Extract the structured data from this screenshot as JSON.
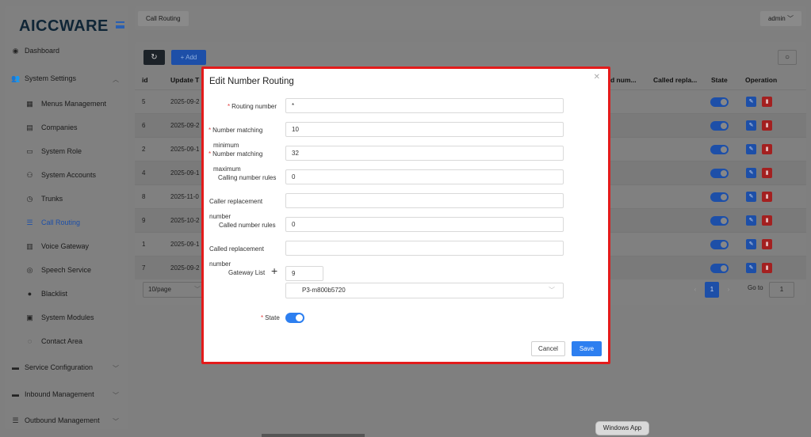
{
  "app": {
    "logo": "AICCWARE"
  },
  "sidebar": {
    "items": [
      {
        "label": "Dashboard",
        "icon": "dashboard-icon",
        "glyph": "◉",
        "level": "top"
      },
      {
        "label": "System Settings",
        "icon": "users-icon",
        "glyph": "👥",
        "level": "top",
        "expanded": true
      },
      {
        "label": "Menus Management",
        "icon": "grid-icon",
        "glyph": "▦",
        "level": "sub"
      },
      {
        "label": "Companies",
        "icon": "table-icon",
        "glyph": "▤",
        "level": "sub"
      },
      {
        "label": "System Role",
        "icon": "role-icon",
        "glyph": "▭",
        "level": "sub"
      },
      {
        "label": "System Accounts",
        "icon": "user-icon",
        "glyph": "⚇",
        "level": "sub"
      },
      {
        "label": "Trunks",
        "icon": "clock-icon",
        "glyph": "◷",
        "level": "sub"
      },
      {
        "label": "Call Routing",
        "icon": "list-icon",
        "glyph": "☰",
        "level": "sub",
        "active": true
      },
      {
        "label": "Voice Gateway",
        "icon": "calendar-icon",
        "glyph": "▥",
        "level": "sub"
      },
      {
        "label": "Speech Service",
        "icon": "speech-icon",
        "glyph": "◎",
        "level": "sub"
      },
      {
        "label": "Blacklist",
        "icon": "person-icon",
        "glyph": "●",
        "level": "sub"
      },
      {
        "label": "System Modules",
        "icon": "modules-icon",
        "glyph": "▣",
        "level": "sub"
      },
      {
        "label": "Contact Area",
        "icon": "location-icon",
        "glyph": "◌",
        "level": "sub"
      },
      {
        "label": "Service Configuration",
        "icon": "config-icon",
        "glyph": "▬",
        "level": "top",
        "expanded": false
      },
      {
        "label": "Inbound Management",
        "icon": "inbound-icon",
        "glyph": "▬",
        "level": "top",
        "expanded": false
      },
      {
        "label": "Outbound Management",
        "icon": "outbound-icon",
        "glyph": "☰",
        "level": "top",
        "expanded": false
      }
    ]
  },
  "topbar": {
    "breadcrumb": "Call Routing",
    "user": "admin"
  },
  "toolbar": {
    "add_label": "+ Add"
  },
  "table": {
    "headers": {
      "id": "id",
      "update": "Update T",
      "called_num": "d num...",
      "called_repl": "Called repla...",
      "state": "State",
      "operation": "Operation"
    },
    "rows": [
      {
        "id": "5",
        "update": "2025-09-2"
      },
      {
        "id": "6",
        "update": "2025-09-2"
      },
      {
        "id": "2",
        "update": "2025-09-1"
      },
      {
        "id": "4",
        "update": "2025-09-1"
      },
      {
        "id": "8",
        "update": "2025-11-0"
      },
      {
        "id": "9",
        "update": "2025-10-2"
      },
      {
        "id": "1",
        "update": "2025-09-1"
      },
      {
        "id": "7",
        "update": "2025-09-2"
      }
    ]
  },
  "pagination": {
    "page_size": "10/page",
    "current_page": "1",
    "goto_label": "Go to",
    "goto_value": "1"
  },
  "modal": {
    "title": "Edit Number Routing",
    "routing_number_label": "Routing number",
    "routing_number_value": "*",
    "min_label_1": "Number matching",
    "min_label_2": "minimum",
    "min_value": "10",
    "max_label_1": "Number matching",
    "max_label_2": "maximum",
    "max_value": "32",
    "calling_rules_label": "Calling number rules",
    "calling_rules_value": "0",
    "caller_repl_label_1": "Caller replacement",
    "caller_repl_label_2": "number",
    "caller_repl_value": "",
    "called_rules_label": "Called number rules",
    "called_rules_value": "0",
    "called_repl_label_1": "Called replacement",
    "called_repl_label_2": "number",
    "called_repl_value": "",
    "gateway_label": "Gateway List",
    "gateway_count": "9",
    "gateway_selected": "P3-m800b5720",
    "state_label": "State",
    "cancel_label": "Cancel",
    "save_label": "Save"
  },
  "dock": {
    "tooltip": "Windows App"
  },
  "colors": {
    "accent": "#2d7ff0",
    "modal_border": "#e31b1b",
    "danger": "#a32020"
  }
}
